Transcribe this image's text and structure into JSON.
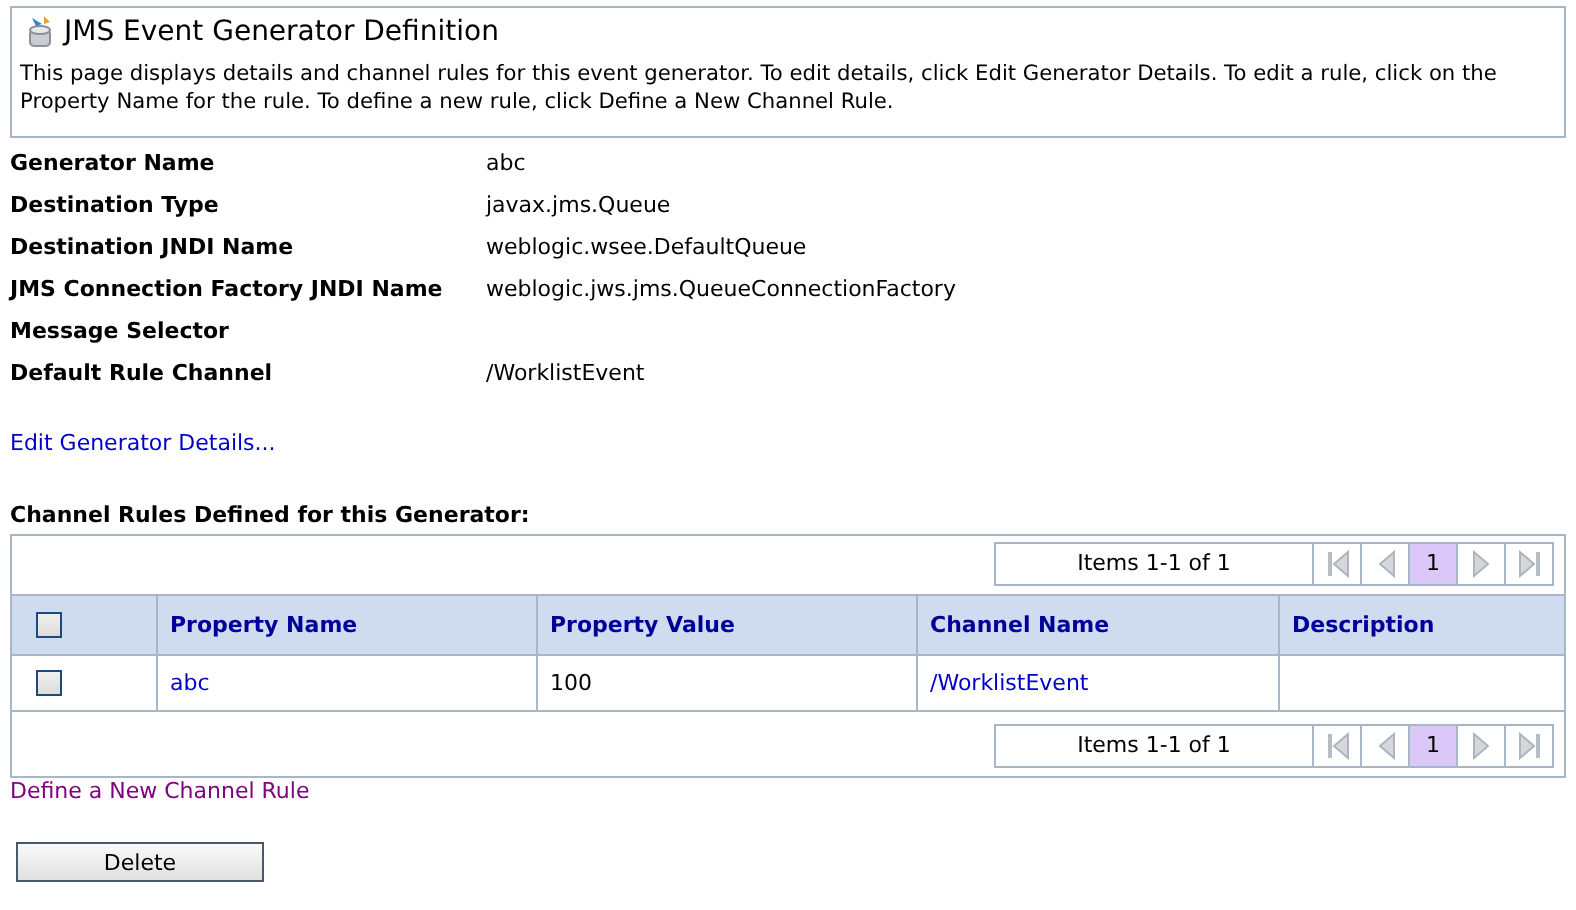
{
  "header": {
    "title": "JMS Event Generator Definition",
    "description": "This page displays details and channel rules for this event generator. To edit details, click Edit Generator Details. To edit a rule, click on the Property Name for the rule. To define a new rule, click Define a New Channel Rule."
  },
  "properties": [
    {
      "label": "Generator Name",
      "value": "abc"
    },
    {
      "label": "Destination Type",
      "value": "javax.jms.Queue"
    },
    {
      "label": "Destination JNDI Name",
      "value": "weblogic.wsee.DefaultQueue"
    },
    {
      "label": "JMS Connection Factory JNDI Name",
      "value": "weblogic.jws.jms.QueueConnectionFactory"
    },
    {
      "label": "Message Selector"
    },
    {
      "label": "Default Rule Channel",
      "value": "/WorklistEvent"
    }
  ],
  "edit_link": "Edit Generator Details...",
  "rules_heading": "Channel Rules Defined for this Generator:",
  "table": {
    "pager_top": {
      "summary": "Items 1-1 of 1",
      "pages": [
        {
          "label": "1",
          "selected": true
        }
      ]
    },
    "select_all_checked": false,
    "columns": [
      "Property Name",
      "Property Value",
      "Channel Name",
      "Description"
    ],
    "rows": [
      {
        "checked": false,
        "property_name": "abc",
        "property_value": "100",
        "channel_name": "/WorklistEvent"
      }
    ],
    "pager_bottom": {
      "summary": "Items 1-1 of 1",
      "pages": [
        {
          "label": "1",
          "selected": true
        }
      ]
    }
  },
  "define_link": "Define a New Channel Rule",
  "buttons": [
    "Delete"
  ]
}
